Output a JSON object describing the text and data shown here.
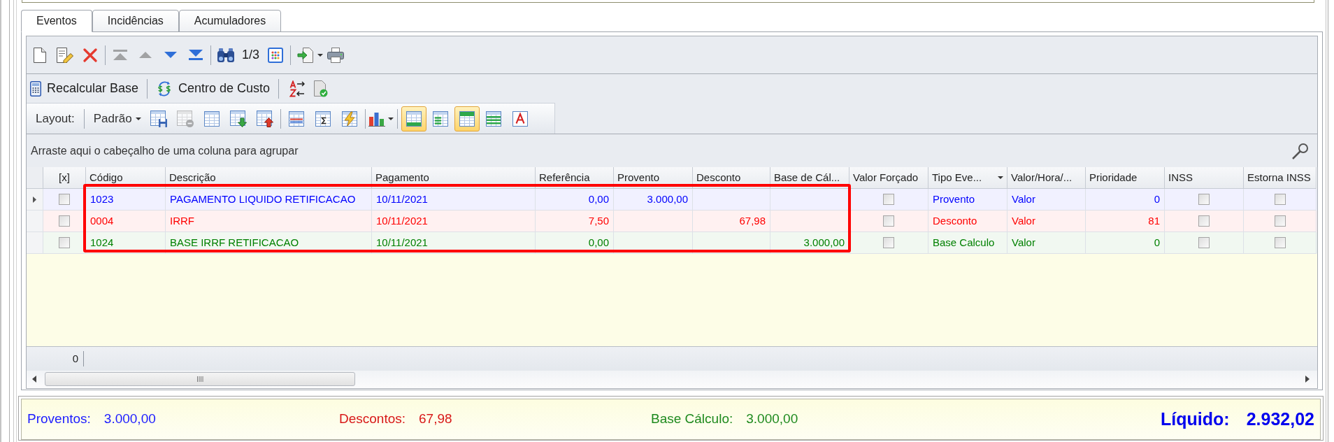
{
  "tabs": [
    {
      "label": "Eventos",
      "selected": true
    },
    {
      "label": "Incidências",
      "selected": false
    },
    {
      "label": "Acumuladores",
      "selected": false
    }
  ],
  "record_toolbar": {
    "groups": [
      [
        {
          "kind": "new",
          "disabled": false
        },
        {
          "kind": "edit",
          "disabled": false
        },
        {
          "kind": "delete",
          "disabled": false
        }
      ],
      [
        {
          "kind": "first",
          "disabled": true
        },
        {
          "kind": "previous",
          "disabled": true
        },
        {
          "kind": "next",
          "disabled": false
        },
        {
          "kind": "last",
          "disabled": false
        }
      ],
      [
        {
          "kind": "find",
          "disabled": false
        },
        {
          "kind": "counter",
          "label": "1/3",
          "disabled": false
        },
        {
          "kind": "columns",
          "disabled": false
        }
      ],
      [
        {
          "kind": "export",
          "disabled": false
        },
        {
          "kind": "print",
          "disabled": false
        }
      ]
    ]
  },
  "action_toolbar": {
    "groups": [
      [
        {
          "kind": "recalculate",
          "label": "Recalcular Base"
        }
      ],
      [
        {
          "kind": "cost_center",
          "label": "Centro de Custo"
        }
      ],
      [
        {
          "kind": "sort"
        },
        {
          "kind": "document"
        }
      ]
    ]
  },
  "layout_toolbar": {
    "label": "Layout:",
    "preset": "Padrão",
    "groups": [
      [
        {
          "kind": "save",
          "disabled": false
        },
        {
          "kind": "clear",
          "disabled": true
        },
        {
          "kind": "grid",
          "disabled": false
        },
        {
          "kind": "import",
          "disabled": false
        },
        {
          "kind": "export",
          "disabled": false
        }
      ],
      [
        {
          "kind": "rows",
          "disabled": false
        },
        {
          "kind": "totals",
          "disabled": false
        },
        {
          "kind": "quick",
          "disabled": false
        }
      ],
      [
        {
          "kind": "chart",
          "disabled": false
        }
      ]
    ],
    "views": [
      {
        "kind": "footer",
        "selected": true
      },
      {
        "kind": "lines",
        "selected": false
      },
      {
        "kind": "header",
        "selected": true
      },
      {
        "kind": "striped",
        "selected": false
      },
      {
        "kind": "font",
        "selected": false
      }
    ]
  },
  "group_panel": {
    "hint": "Arraste aqui o cabeçalho de uma coluna para agrupar"
  },
  "table": {
    "columns": [
      {
        "label": "[x]",
        "kind": "select",
        "dropdown": false
      },
      {
        "label": "Código",
        "kind": "text",
        "dropdown": false
      },
      {
        "label": "Descrição",
        "kind": "text",
        "dropdown": false
      },
      {
        "label": "Pagamento",
        "kind": "text",
        "dropdown": false
      },
      {
        "label": "Referência",
        "kind": "number",
        "dropdown": false
      },
      {
        "label": "Provento",
        "kind": "number",
        "dropdown": false
      },
      {
        "label": "Desconto",
        "kind": "number",
        "dropdown": false
      },
      {
        "label": "Base de Cál...",
        "kind": "number",
        "dropdown": false
      },
      {
        "label": "Valor Forçado",
        "kind": "check",
        "dropdown": false
      },
      {
        "label": "Tipo Eve...",
        "kind": "text",
        "dropdown": true
      },
      {
        "label": "Valor/Hora/...",
        "kind": "text",
        "dropdown": false
      },
      {
        "label": "Prioridade",
        "kind": "number",
        "dropdown": false
      },
      {
        "label": "INSS",
        "kind": "check",
        "dropdown": false
      },
      {
        "label": "Estorna INSS",
        "kind": "check",
        "dropdown": false
      }
    ],
    "rows": [
      {
        "current": true,
        "color": "#0000ff",
        "checked": false,
        "code": "1023",
        "description": "PAGAMENTO LIQUIDO RETIFICACAO",
        "payment": "10/11/2021",
        "reference": "0,00",
        "earning": "3.000,00",
        "forced": false,
        "type": "Provento",
        "value_basis": "Valor",
        "priority": "0",
        "inss": false,
        "reverse_inss": false
      },
      {
        "current": false,
        "color": "#ff0000",
        "checked": false,
        "code": "0004",
        "description": "IRRF",
        "payment": "10/11/2021",
        "reference": "7,50",
        "deduction": "67,98",
        "forced": false,
        "type": "Desconto",
        "value_basis": "Valor",
        "priority": "81",
        "inss": false,
        "reverse_inss": false
      },
      {
        "current": false,
        "color": "#008000",
        "checked": false,
        "code": "1024",
        "description": "BASE IRRF RETIFICACAO",
        "payment": "10/11/2021",
        "reference": "0,00",
        "calc_base": "3.000,00",
        "forced": false,
        "type": "Base Calculo",
        "value_basis": "Valor",
        "priority": "0",
        "inss": false,
        "reverse_inss": false
      }
    ],
    "footer": {
      "count": "0"
    }
  },
  "totals": [
    {
      "kind": "item",
      "label": "Proventos:",
      "value": "3.000,00",
      "color": "#1c1cff"
    },
    {
      "kind": "item",
      "label": "Descontos:",
      "value": "67,98",
      "color": "#d81818"
    },
    {
      "kind": "item",
      "label": "Base Cálculo:",
      "value": "3.000,00",
      "color": "#1e8a1e"
    },
    {
      "kind": "net",
      "label": "Líquido:",
      "value": "2.932,02",
      "color": "#0000ee"
    }
  ]
}
